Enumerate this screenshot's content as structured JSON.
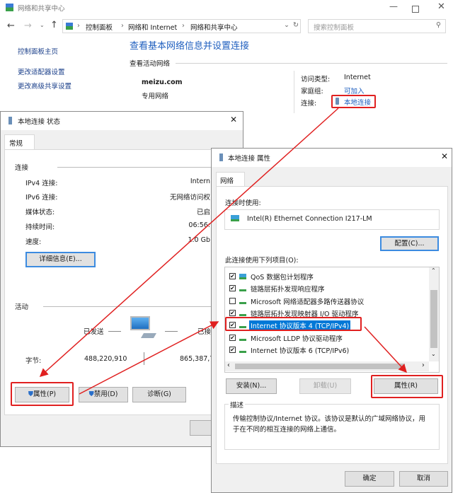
{
  "main": {
    "title": "网络和共享中心",
    "breadcrumb": [
      "控制面板",
      "网络和 Internet",
      "网络和共享中心"
    ],
    "search_placeholder": "搜索控制面板",
    "sidebar": [
      "控制面板主页",
      "更改适配器设置",
      "更改高级共享设置"
    ],
    "heading": "查看基本网络信息并设置连接",
    "active_label": "查看活动网络",
    "network_name": "meizu.com",
    "network_type": "专用网络",
    "access_label": "访问类型:",
    "access_value": "Internet",
    "homegroup_label": "家庭组:",
    "homegroup_value": "可加入",
    "conn_label": "连接:",
    "conn_value": "本地连接"
  },
  "status": {
    "title": "本地连接 状态",
    "tab": "常规",
    "section_conn": "连接",
    "rows": [
      {
        "label": "IPv4 连接:",
        "value": "Intern"
      },
      {
        "label": "IPv6 连接:",
        "value": "无网络访问权"
      },
      {
        "label": "媒体状态:",
        "value": "已启"
      },
      {
        "label": "持续时间:",
        "value": "06:56:"
      },
      {
        "label": "速度:",
        "value": "1.0 Gb"
      }
    ],
    "details_btn": "详细信息(E)...",
    "section_activity": "活动",
    "sent": "已发送",
    "received": "已接",
    "bytes_label": "字节:",
    "bytes_sent": "488,220,910",
    "bytes_received": "865,387,7",
    "properties_btn": "属性(P)",
    "disable_btn": "禁用(D)",
    "diagnose_btn": "诊断(G)",
    "close_btn": "关"
  },
  "props": {
    "title": "本地连接 属性",
    "tab": "网络",
    "connect_using": "连接时使用:",
    "adapter": "Intel(R) Ethernet Connection I217-LM",
    "configure_btn": "配置(C)...",
    "items_label": "此连接使用下列项目(O):",
    "items": [
      {
        "label": "QoS 数据包计划程序",
        "checked": true
      },
      {
        "label": "链路层拓扑发现响应程序",
        "checked": true
      },
      {
        "label": "Microsoft 网络适配器多路传送器协议",
        "checked": false
      },
      {
        "label": "链路层拓扑发现映射器 I/O 驱动程序",
        "checked": true
      },
      {
        "label": "Internet 协议版本 4 (TCP/IPv4)",
        "checked": true
      },
      {
        "label": "Microsoft LLDP 协议驱动程序",
        "checked": true
      },
      {
        "label": "Internet 协议版本 6 (TCP/IPv6)",
        "checked": true
      }
    ],
    "install_btn": "安装(N)...",
    "uninstall_btn": "卸载(U)",
    "properties_btn": "属性(R)",
    "desc_label": "描述",
    "desc_line1": "传输控制协议/Internet 协议。该协议是默认的广域网络协议，用",
    "desc_line2": "于在不同的相互连接的网络上通信。",
    "ok_btn": "确定",
    "cancel_btn": "取消"
  },
  "colors": {
    "accent": "#1f5fbf",
    "highlight": "#0078d7",
    "annotation": "#e02020"
  }
}
